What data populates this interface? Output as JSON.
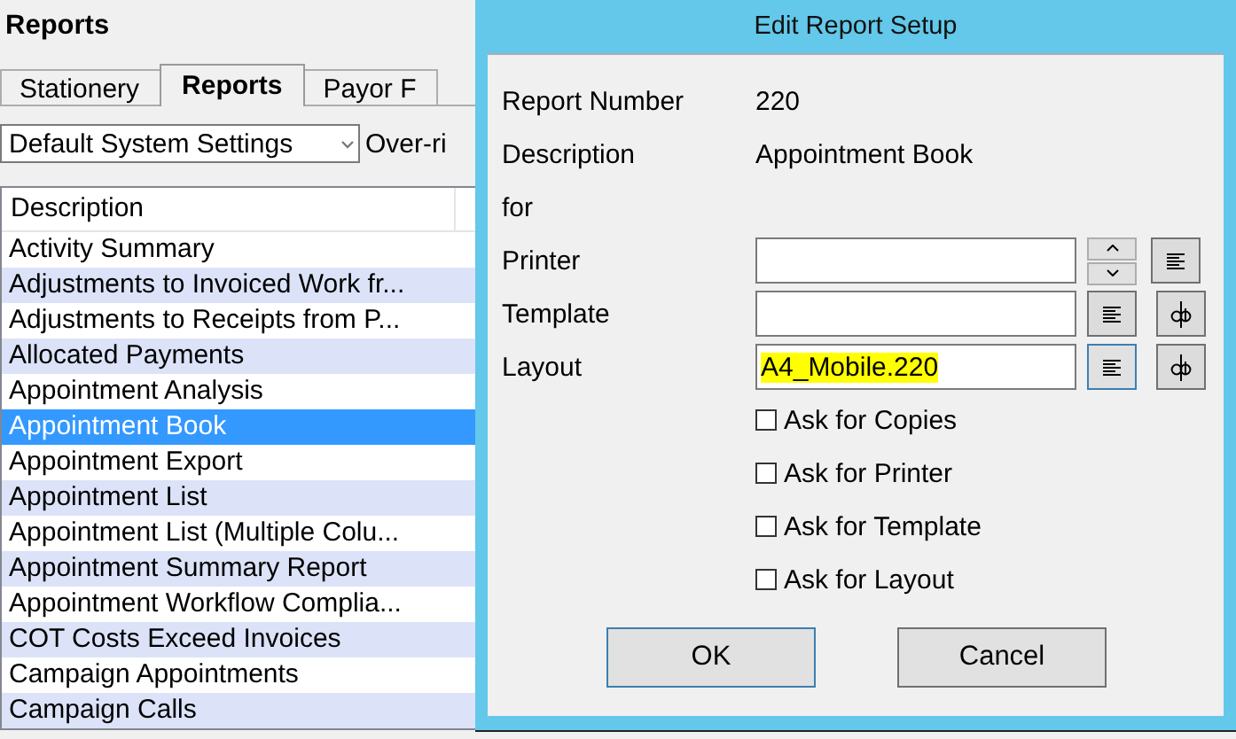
{
  "window": {
    "title": "Reports"
  },
  "tabs": [
    {
      "label": "Stationery",
      "selected": false
    },
    {
      "label": "Reports",
      "selected": true
    },
    {
      "label": "Payor F",
      "selected": false
    }
  ],
  "settings_dropdown": {
    "value": "Default System Settings"
  },
  "override_label": "Over-ri",
  "table": {
    "columns": [
      "Description"
    ],
    "rows": [
      {
        "cells": [
          "Activity Summary"
        ],
        "selected": false
      },
      {
        "cells": [
          "Adjustments to Invoiced Work fr..."
        ],
        "selected": false
      },
      {
        "cells": [
          "Adjustments to Receipts from P..."
        ],
        "selected": false
      },
      {
        "cells": [
          "Allocated Payments"
        ],
        "selected": false
      },
      {
        "cells": [
          "Appointment Analysis"
        ],
        "selected": false
      },
      {
        "cells": [
          "Appointment Book"
        ],
        "selected": true
      },
      {
        "cells": [
          "Appointment Export"
        ],
        "selected": false
      },
      {
        "cells": [
          "Appointment List"
        ],
        "selected": false
      },
      {
        "cells": [
          "Appointment List (Multiple Colu..."
        ],
        "selected": false
      },
      {
        "cells": [
          "Appointment Summary Report"
        ],
        "selected": false
      },
      {
        "cells": [
          "Appointment Workflow Complia..."
        ],
        "selected": false
      },
      {
        "cells": [
          "COT Costs Exceed Invoices"
        ],
        "selected": false
      },
      {
        "cells": [
          "Campaign Appointments"
        ],
        "selected": false
      },
      {
        "cells": [
          "Campaign Calls"
        ],
        "selected": false
      }
    ]
  },
  "dialog": {
    "title": "Edit Report Setup",
    "info": [
      {
        "label": "Report Number",
        "value": "220"
      },
      {
        "label": "Description",
        "value": "Appointment Book"
      },
      {
        "label": "for"
      }
    ],
    "fields": [
      {
        "label": "Printer",
        "tools": [
          {
            "kind": "spin"
          },
          {
            "kind": "align",
            "focused": false
          }
        ]
      },
      {
        "label": "Template",
        "tools": [
          {
            "kind": "align",
            "focused": false
          },
          {
            "kind": "cursor",
            "focused": false
          }
        ]
      },
      {
        "label": "Layout",
        "value": "A4_Mobile.220",
        "highlighted": true,
        "tools": [
          {
            "kind": "align",
            "focused": true
          },
          {
            "kind": "cursor",
            "focused": false
          }
        ]
      }
    ],
    "checkboxes": [
      {
        "label": "Ask for Copies",
        "checked": false
      },
      {
        "label": "Ask for Printer",
        "checked": false
      },
      {
        "label": "Ask for Template",
        "checked": false
      },
      {
        "label": "Ask for Layout",
        "checked": false
      }
    ],
    "buttons": [
      {
        "label": "OK",
        "default": true
      },
      {
        "label": "Cancel",
        "default": false
      }
    ]
  }
}
